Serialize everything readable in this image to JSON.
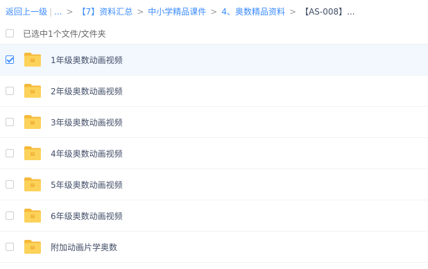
{
  "breadcrumb": {
    "back_label": "返回上一级",
    "ellipsis": "...",
    "crumbs": [
      "【7】资料汇总",
      "中小学精品课件",
      "4、奥数精品资料"
    ],
    "current": "【AS-008】..."
  },
  "selection": {
    "label": "已选中1个文件/文件夹"
  },
  "colors": {
    "accent": "#3b8cff",
    "folder": "#fcd25a",
    "folder_dark": "#f5b93a",
    "selected_row": "#f3f8ff"
  },
  "files": [
    {
      "name": "1年级奥数动画视频",
      "checked": true,
      "icon": "folder-icon"
    },
    {
      "name": "2年级奥数动画视频",
      "checked": false,
      "icon": "folder-icon"
    },
    {
      "name": "3年级奥数动画视频",
      "checked": false,
      "icon": "folder-icon"
    },
    {
      "name": "4年级奥数动画视频",
      "checked": false,
      "icon": "folder-icon"
    },
    {
      "name": "5年级奥数动画视频",
      "checked": false,
      "icon": "folder-icon"
    },
    {
      "name": "6年级奥数动画视频",
      "checked": false,
      "icon": "folder-icon"
    },
    {
      "name": "附加动画片学奥数",
      "checked": false,
      "icon": "folder-icon"
    }
  ]
}
